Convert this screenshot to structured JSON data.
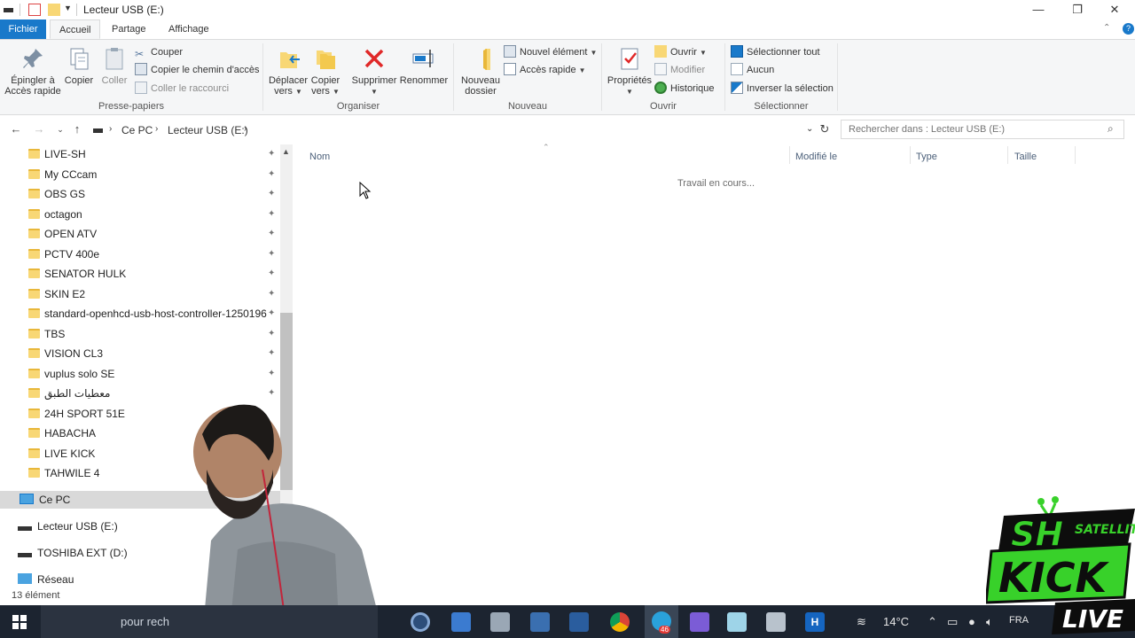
{
  "window": {
    "title": "Lecteur USB (E:)"
  },
  "ribbon_tabs": {
    "file": "Fichier",
    "home": "Accueil",
    "share": "Partage",
    "view": "Affichage"
  },
  "ribbon": {
    "clipboard": {
      "pin_label_1": "Épingler à",
      "pin_label_2": "Accès rapide",
      "copy": "Copier",
      "paste": "Coller",
      "cut": "Couper",
      "copy_path": "Copier le chemin d'accès",
      "paste_shortcut": "Coller le raccourci",
      "group": "Presse-papiers"
    },
    "organize": {
      "move_1": "Déplacer",
      "move_2": "vers",
      "copyto_1": "Copier",
      "copyto_2": "vers",
      "delete": "Supprimer",
      "rename": "Renommer",
      "group": "Organiser"
    },
    "new": {
      "folder_1": "Nouveau",
      "folder_2": "dossier",
      "new_item": "Nouvel élément",
      "quick_access": "Accès rapide",
      "group": "Nouveau"
    },
    "open": {
      "properties": "Propriétés",
      "open": "Ouvrir",
      "edit": "Modifier",
      "history": "Historique",
      "group": "Ouvrir"
    },
    "select": {
      "select_all": "Sélectionner tout",
      "none": "Aucun",
      "invert": "Inverser la sélection",
      "group": "Sélectionner"
    }
  },
  "address": {
    "crumbs": [
      "Ce PC",
      "Lecteur USB (E:)"
    ],
    "search_placeholder": "Rechercher dans : Lecteur USB (E:)"
  },
  "nav": {
    "folders": [
      "LIVE-SH",
      "My CCcam",
      "OBS GS",
      "octagon",
      "OPEN ATV",
      "PCTV 400e",
      "SENATOR HULK",
      "SKIN E2",
      "standard-openhcd-usb-host-controller-1250196",
      "TBS",
      "VISION CL3",
      "vuplus solo SE",
      "معطيات الطبق",
      "24H SPORT 51E",
      "HABACHA",
      "LIVE KICK",
      "TAHWILE 4"
    ],
    "this_pc": "Ce PC",
    "usb": "Lecteur USB (E:)",
    "toshiba": "TOSHIBA EXT (D:)",
    "network": "Réseau"
  },
  "content": {
    "col_name": "Nom",
    "col_modified": "Modifié le",
    "col_type": "Type",
    "col_size": "Taille",
    "working": "Travail en cours..."
  },
  "status": {
    "count": "13 élément"
  },
  "taskbar": {
    "search_text": "pour rech",
    "temperature": "14°C",
    "language": "FRA",
    "badge": "46"
  },
  "logo": {
    "line1": "SH",
    "line2": "SATELLITE",
    "line3": "KICK",
    "line4": "LIVE"
  },
  "colors": {
    "accent": "#1979ca",
    "logo_green": "#38d12a"
  }
}
